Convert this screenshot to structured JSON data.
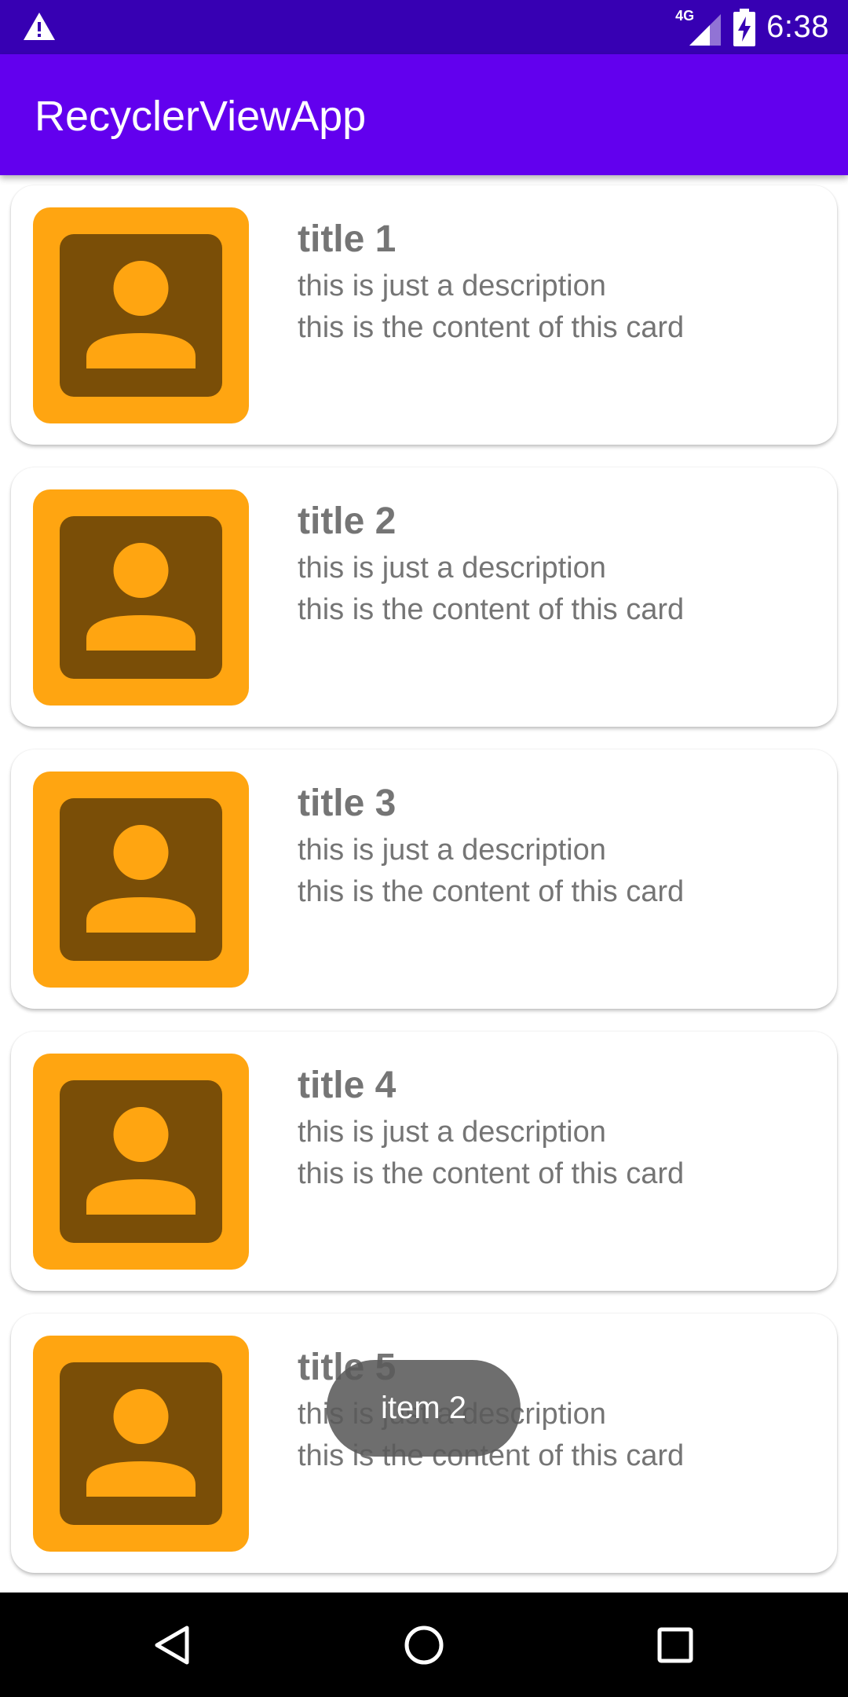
{
  "status_bar": {
    "time": "6:38",
    "network": "4G",
    "alert_icon": "warning-icon",
    "signal_icon": "cell-signal-icon",
    "battery_icon": "battery-charging-icon"
  },
  "app_bar": {
    "title": "RecyclerViewApp"
  },
  "cards": [
    {
      "title": "title 1",
      "description": "this is just a description",
      "content": "this is the content of this card",
      "icon": "contact-person-icon"
    },
    {
      "title": "title 2",
      "description": "this is just a description",
      "content": "this is the content of this card",
      "icon": "contact-person-icon"
    },
    {
      "title": "title 3",
      "description": "this is just a description",
      "content": "this is the content of this card",
      "icon": "contact-person-icon"
    },
    {
      "title": "title 4",
      "description": "this is just a description",
      "content": "this is the content of this card",
      "icon": "contact-person-icon"
    },
    {
      "title": "title 5",
      "description": "this is just a description",
      "content": "this is the content of this card",
      "icon": "contact-person-icon"
    }
  ],
  "toast": {
    "text": "item 2"
  },
  "nav_bar": {
    "back_icon": "back-triangle-icon",
    "home_icon": "home-circle-icon",
    "recents_icon": "recents-square-icon"
  },
  "colors": {
    "status_bar": "#3700b3",
    "app_bar": "#6200ee",
    "image_bg": "#ffa511",
    "image_fg": "#7a4e07",
    "text": "#757575"
  }
}
